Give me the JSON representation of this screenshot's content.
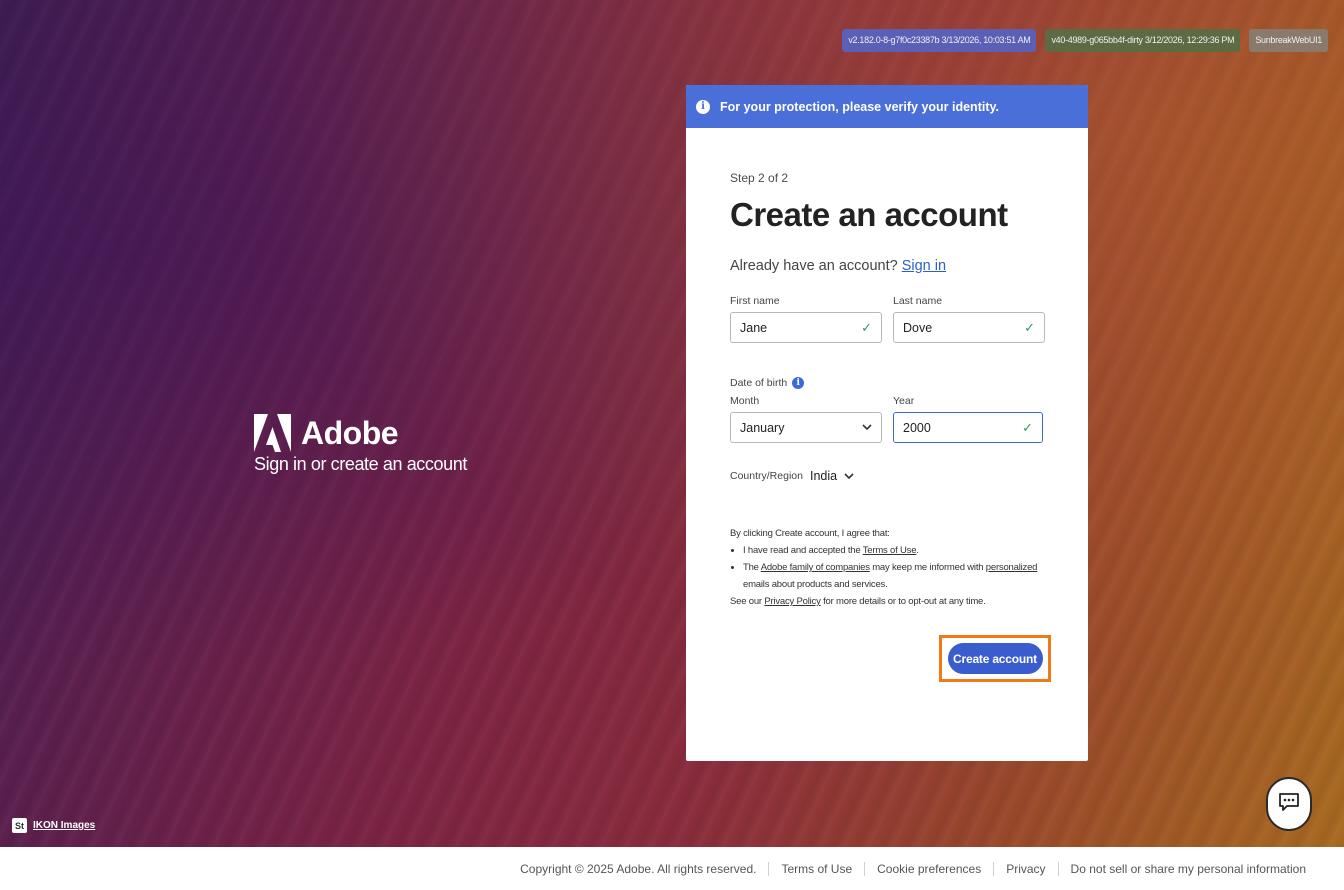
{
  "version_badges": [
    "v2.182.0-8-g7f0c23387b 3/13/2026, 10:03:51 AM",
    "v40-4989-g065bb4f-dirty 3/12/2026, 12:29:36 PM",
    "SunbreakWebUI1"
  ],
  "brand": {
    "name": "Adobe",
    "tagline": "Sign in or create an account"
  },
  "banner": {
    "text": "For your protection, please verify your identity.",
    "icon": "info-icon"
  },
  "form": {
    "step": "Step 2 of 2",
    "title": "Create an account",
    "already_text": "Already have an account?",
    "sign_in_link": "Sign in",
    "first_name": {
      "label": "First name",
      "value": "Jane"
    },
    "last_name": {
      "label": "Last name",
      "value": "Dove"
    },
    "dob_label": "Date of birth",
    "month": {
      "label": "Month",
      "value": "January"
    },
    "year": {
      "label": "Year",
      "value": "2000"
    },
    "country": {
      "label": "Country/Region",
      "value": "India"
    },
    "legal": {
      "intro": "By clicking Create account, I agree that:",
      "item1_pre": "I have read and accepted the ",
      "item1_link": "Terms of Use",
      "item1_post": ".",
      "item2_pre": "The ",
      "item2_link1": "Adobe family of companies",
      "item2_mid": " may keep me informed with ",
      "item2_link2": "personalized",
      "item2_post": " emails about products and services.",
      "see_pre": "See our ",
      "see_link": "Privacy Policy",
      "see_post": " for more details or to opt-out at any time."
    },
    "submit_label": "Create account"
  },
  "ikon": {
    "badge": "St",
    "label": "IKON Images"
  },
  "footer": {
    "copyright": "Copyright © 2025 Adobe. All rights reserved.",
    "links": [
      "Terms of Use",
      "Cookie preferences",
      "Privacy",
      "Do not sell or share my personal information"
    ]
  },
  "colors": {
    "banner": "#4a6fd8",
    "primary_button": "#3a5ccc",
    "highlight_outline": "#f07a14",
    "valid_check": "#2d9a5c"
  }
}
